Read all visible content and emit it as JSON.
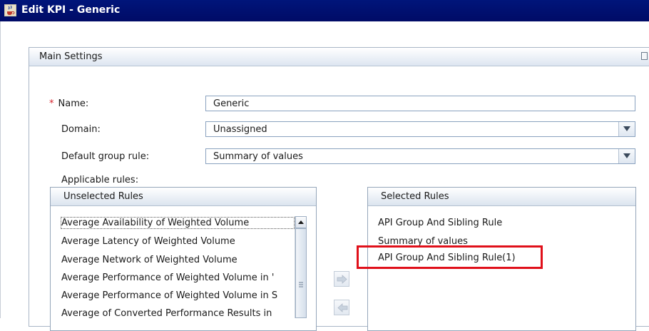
{
  "window": {
    "title": "Edit KPI - Generic"
  },
  "main_settings": {
    "header": "Main Settings"
  },
  "form": {
    "required_mark": "*",
    "name_label": "Name:",
    "name_value": "Generic",
    "domain_label": "Domain:",
    "domain_value": "Unassigned",
    "group_rule_label": "Default group rule:",
    "group_rule_value": "Summary of values",
    "applicable_rules_label": "Applicable rules:"
  },
  "unselected_rules": {
    "header": "Unselected Rules",
    "items": [
      "Average Availability of Weighted Volume",
      "Average Latency of Weighted Volume",
      "Average Network of Weighted Volume",
      "Average Performance of Weighted Volume in '",
      "Average Performance of Weighted Volume in S",
      "Average of Converted Performance Results in"
    ]
  },
  "selected_rules": {
    "header": "Selected Rules",
    "items": [
      "API Group And Sibling Rule",
      "Summary of values",
      "API Group And Sibling Rule(1)"
    ]
  },
  "icons": {
    "app": "java-cup-icon",
    "dropdown": "chevron-down-icon",
    "add": "arrow-right-icon",
    "remove": "arrow-left-icon"
  },
  "colors": {
    "titlebar": "#000b66",
    "highlight": "#e0101a",
    "required": "#d6202a"
  }
}
